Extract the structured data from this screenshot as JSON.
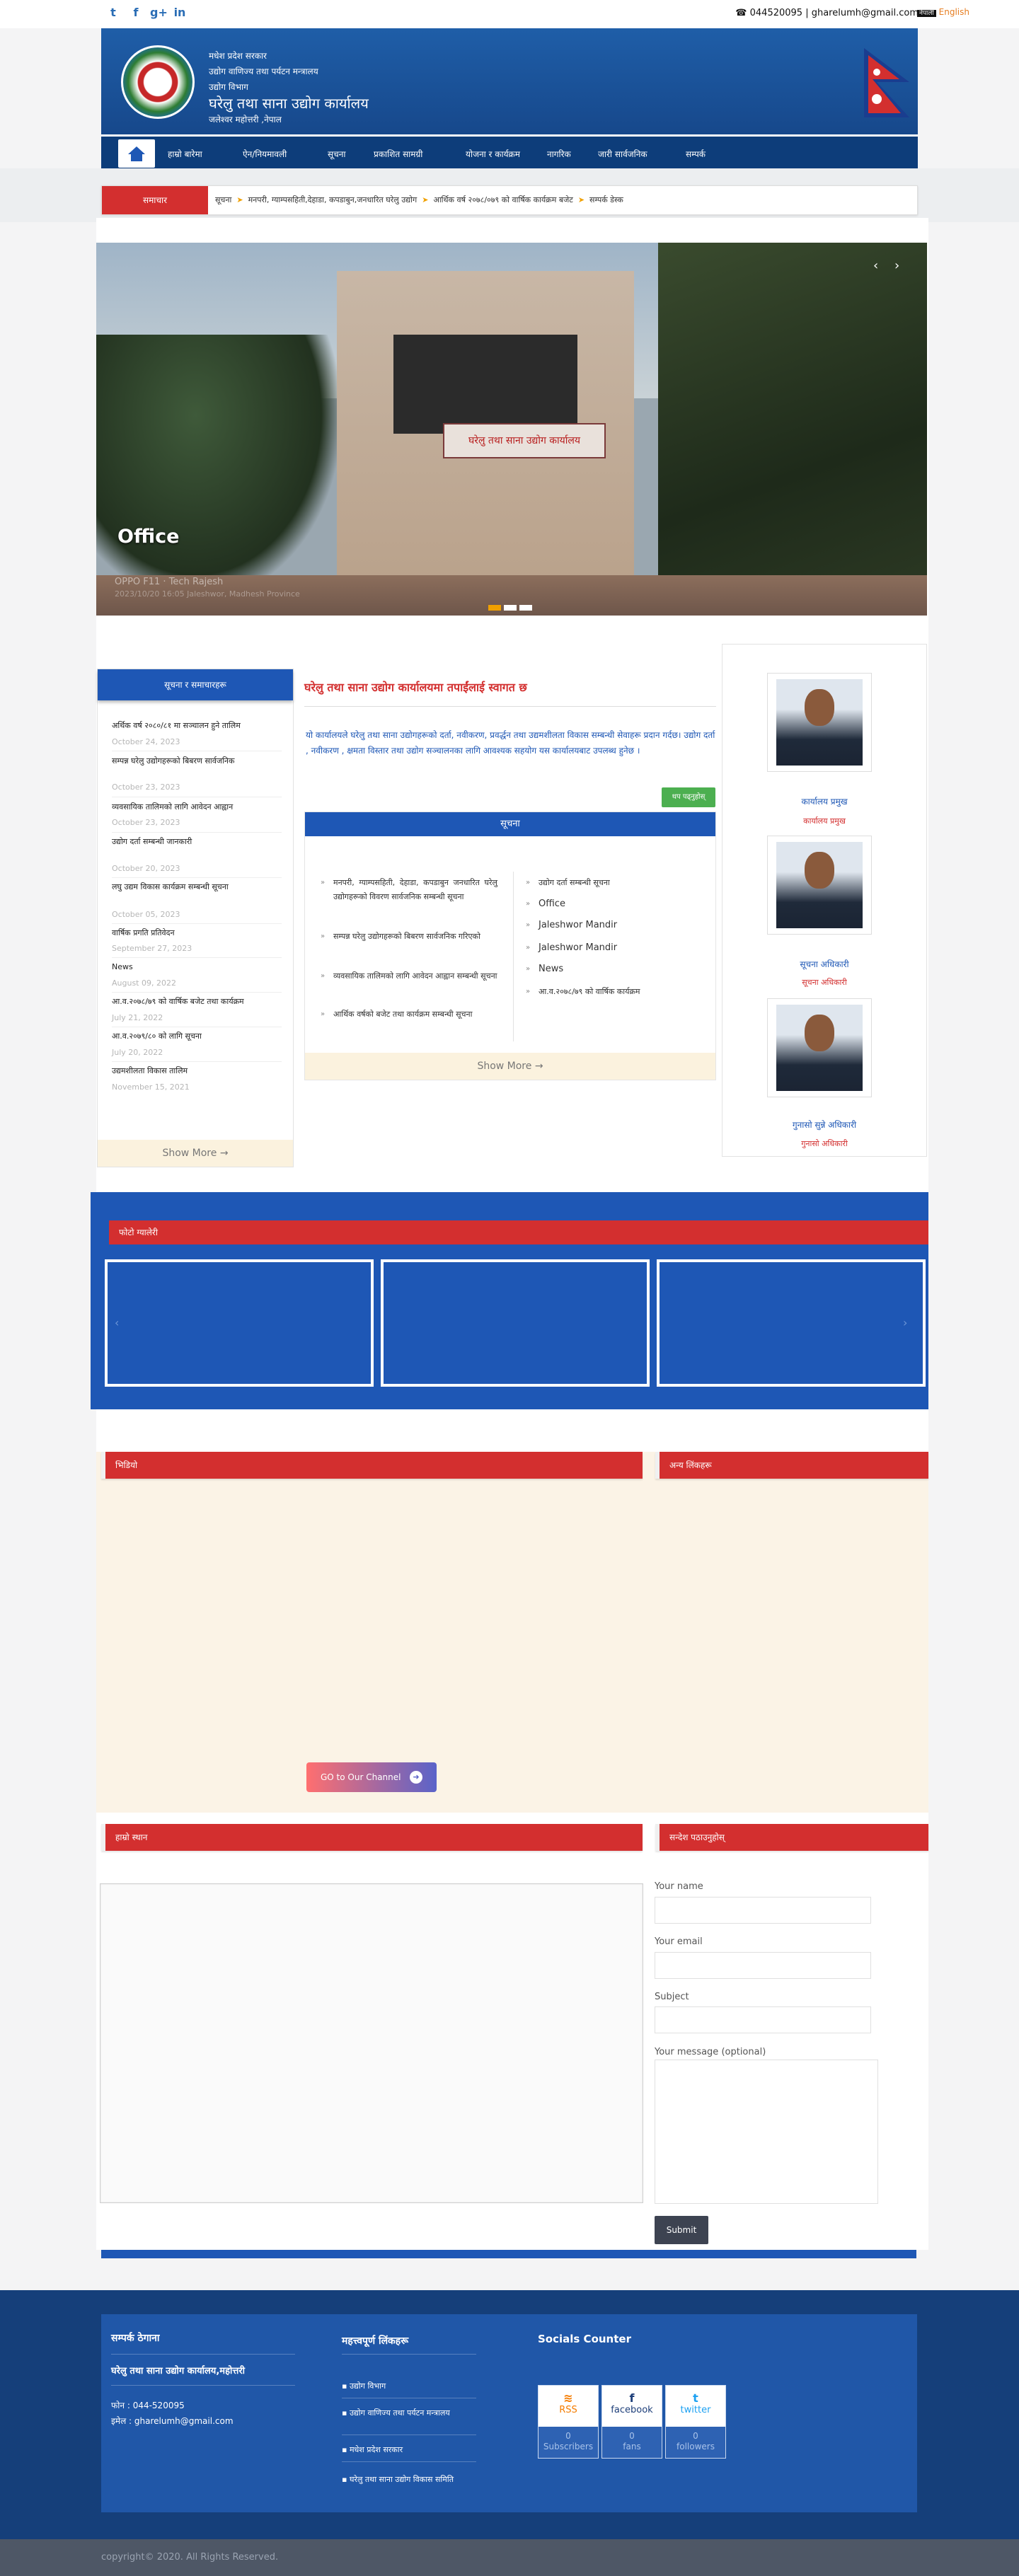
{
  "topbar": {
    "social": [
      {
        "icon": "twitter-icon",
        "glyph": "t"
      },
      {
        "icon": "facebook-icon",
        "glyph": "f"
      },
      {
        "icon": "google-plus-icon",
        "glyph": "g+"
      },
      {
        "icon": "linkedin-icon",
        "glyph": "in"
      }
    ],
    "phone_icon": "☎",
    "contact": "044520095 | gharelumh@gmail.com",
    "lang_nepali": "नेपाली",
    "lang_english": "English"
  },
  "header": {
    "line1": "मधेश प्रदेश सरकार",
    "line2": "उद्योग वाणिज्य तथा पर्यटन मन्त्रालय",
    "line3": "उद्योग विभाग",
    "office": "घरेलु तथा साना उद्योग कार्यालय",
    "location": "जलेश्वर महोत्तरी ,नेपाल"
  },
  "nav": {
    "items": [
      "हाम्रो बारेमा",
      "ऐन/नियमावली",
      "सूचना",
      "प्रकाशित सामग्री",
      "योजना र कार्यक्रम",
      "नागरिक",
      "जारी सार्वजनिक",
      "सम्पर्क"
    ]
  },
  "ticker": {
    "label": "समाचार",
    "items": [
      "सूचना",
      "मनपरी, ग्याम्पसहिती,देहाडा, कपडाबुन,जनधारित घरेलु उद्योग",
      "आर्थिक वर्ष २०७८/०७९ को वार्षिक कार्यक्रम बजेट",
      "सम्पर्क डेस्क"
    ]
  },
  "slider": {
    "caption": "Office",
    "meta1": "OPPO F11 · Tech Rajesh",
    "meta2": "2023/10/20 16:05  Jaleshwor, Madhesh Province"
  },
  "left_news": {
    "heading": "सूचना र समाचारहरू",
    "items": [
      {
        "title": "अर्थिक वर्ष २०८०/८१ मा सञ्चालन हुने तालिम",
        "date": "October 24, 2023"
      },
      {
        "title": "सम्पन्न घरेलु उद्योगहरूको बिबरण सार्वजनिक",
        "date": "October 23, 2023"
      },
      {
        "title": "व्यवसायिक तालिमको लागि आवेदन आह्वान",
        "date": "October 23, 2023"
      },
      {
        "title": "उद्योग दर्ता सम्बन्धी जानकारी",
        "date": "October 20, 2023"
      },
      {
        "title": "लघु उद्यम विकास कार्यक्रम सम्बन्धी सूचना",
        "date": "October 05, 2023"
      },
      {
        "title": "वार्षिक प्रगति प्रतिवेदन",
        "date": "September 27, 2023"
      },
      {
        "title": "News",
        "date": "August 09, 2022"
      },
      {
        "title": "आ.व.२०७८/७९ को वार्षिक बजेट तथा कार्यक्रम",
        "date": "July 21, 2022"
      },
      {
        "title": "आ.व.२०७९/८० को लागि सूचना",
        "date": "July 20, 2022"
      },
      {
        "title": "उद्यमशीलता विकास तालिम",
        "date": "November 15, 2021"
      }
    ],
    "more": "Show More →"
  },
  "center": {
    "title": "घरेलु तथा साना उद्योग कार्यालयमा तपाईंलाई स्वागत छ",
    "body": "यो कार्यालयले घरेलु तथा साना उद्योगहरूको दर्ता, नवीकरण, प्रवर्द्धन तथा उद्यमशीलता विकास सम्बन्धी सेवाहरू प्रदान गर्दछ। उद्योग दर्ता , नवीकरण , क्षमता विस्तार तथा उद्योग सञ्चालनका लागि आवश्यक सहयोग यस कार्यालयबाट उपलब्ध हुनेछ ।",
    "readmore": "थप पढ्नुहोस्"
  },
  "notice": {
    "heading": "सूचना",
    "left_items": [
      "मनपरी, ग्याम्पसहिती, देहाडा, कपडाबुन जनधारित घरेलु उद्योगहरूको विवरण सार्वजनिक सम्बन्धी सूचना",
      "सम्पन्न घरेलु उद्योगहरूको बिबरण सार्वजनिक गरिएको",
      "व्यवसायिक तालिमको लागि आवेदन आह्वान सम्बन्धी सूचना",
      "आर्थिक वर्षको बजेट तथा कार्यक्रम सम्बन्धी सूचना"
    ],
    "right_items": [
      "उद्योग दर्ता सम्बन्धी सूचना",
      "Office",
      "Jaleshwor Mandir",
      "Jaleshwor Mandir",
      "News",
      "आ.व.२०७८/७९ को वार्षिक कार्यक्रम"
    ],
    "more": "Show More →"
  },
  "staff": [
    {
      "name": "कार्यालय प्रमुख",
      "role": "कार्यालय प्रमुख"
    },
    {
      "name": "सूचना अधिकारी",
      "role": "सूचना अधिकारी"
    },
    {
      "name": "गुनासो सुन्ने अधिकारी",
      "role": "गुनासो अधिकारी"
    }
  ],
  "gallery": {
    "heading": "फोटो ग्यालेरी"
  },
  "video": {
    "left_heading": "भिडियो",
    "right_heading": "अन्य लिंकहरू",
    "button": "GO to Our Channel"
  },
  "contact": {
    "left_heading": "हाम्रो स्थान",
    "right_heading": "सन्देश पठाउनुहोस्",
    "name_label": "Your name",
    "email_label": "Your email",
    "subject_label": "Subject",
    "message_label": "Your message (optional)",
    "submit": "Submit"
  },
  "footer": {
    "col1_head": "सम्पर्क ठेगाना",
    "col1_office": "घरेलु तथा साना उद्योग कार्यालय,महोत्तरी",
    "col1_phone": "फोन : 044-520095",
    "col1_email": "इमेल : gharelumh@gmail.com",
    "col2_head": "महत्त्वपूर्ण लिंकहरू",
    "links": [
      "उद्योग विभाग",
      "उद्योग वाणिज्य तथा पर्यटन मन्त्रालय",
      "मधेश प्रदेश सरकार",
      "घरेलु तथा साना उद्योग विकास समिति"
    ],
    "col3_head": "Socials Counter",
    "counters": [
      {
        "label": "RSS",
        "count": "0",
        "unit": "Subscribers",
        "icon": "rss-icon",
        "glyph": "≋",
        "color": "#f57c00"
      },
      {
        "label": "facebook",
        "count": "0",
        "unit": "fans",
        "icon": "facebook-icon",
        "glyph": "f",
        "color": "#1e3f7a"
      },
      {
        "label": "twitter",
        "count": "0",
        "unit": "followers",
        "icon": "twitter-icon",
        "glyph": "t",
        "color": "#1da1f2"
      }
    ],
    "copyright": "copyright© 2020. All Rights Reserved."
  }
}
